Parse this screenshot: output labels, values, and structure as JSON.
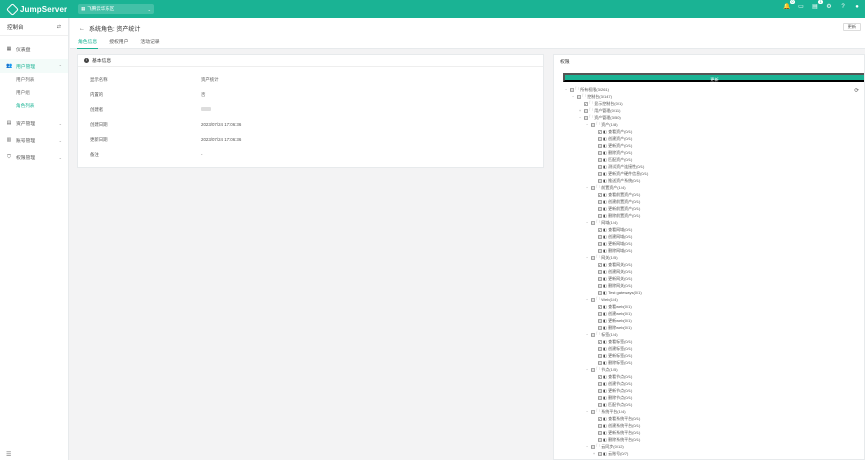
{
  "app": {
    "brand": "JumpServer",
    "org": "飞腾云华东区",
    "notif_count_1": "0",
    "notif_count_2": "1"
  },
  "colors": {
    "accent": "#1ab394"
  },
  "sidebar": {
    "title": "控制台",
    "items": [
      {
        "label": "仪表盘",
        "icon": "dashboard-icon"
      },
      {
        "label": "用户管理",
        "icon": "user-icon"
      },
      {
        "label": "资产管理",
        "icon": "asset-icon"
      },
      {
        "label": "账号管理",
        "icon": "account-icon"
      },
      {
        "label": "权限管理",
        "icon": "permission-icon"
      }
    ],
    "subitems": [
      {
        "label": "用户列表"
      },
      {
        "label": "用户组"
      },
      {
        "label": "角色列表"
      }
    ]
  },
  "header": {
    "title": "系统角色: 资产统计",
    "refresh_label": "更新",
    "tabs": [
      {
        "label": "角色信息"
      },
      {
        "label": "授权用户"
      },
      {
        "label": "活动记录"
      }
    ]
  },
  "info": {
    "title": "基本信息",
    "rows": [
      {
        "label": "显示名称",
        "value": "资产统计"
      },
      {
        "label": "内置的",
        "value": "否"
      },
      {
        "label": "创建者",
        "value": ""
      },
      {
        "label": "创建日期",
        "value": "2023/07/24 17:06:36"
      },
      {
        "label": "更新日期",
        "value": "2023/07/24 17:06:36"
      },
      {
        "label": "备注",
        "value": "-"
      }
    ]
  },
  "permissions": {
    "title": "权限",
    "update_label": "更新",
    "tree": [
      {
        "text": "所有权限(3/261)",
        "level": 0,
        "tog": "−",
        "cb": "□"
      },
      {
        "text": "控制台(3/147)",
        "level": 1,
        "tog": "−",
        "cb": "□"
      },
      {
        "text": "显示控制台(0/1)",
        "level": 2,
        "tog": "",
        "cb": "✓"
      },
      {
        "text": "用户管理(0/11)",
        "level": 2,
        "tog": "+",
        "cb": "□"
      },
      {
        "text": "资产管理(3/50)",
        "level": 2,
        "tog": "−",
        "cb": "□"
      },
      {
        "text": "资产(1/8)",
        "level": 3,
        "tog": "−",
        "cb": "□"
      },
      {
        "text": "查看资产(0/1)",
        "level": 4,
        "tog": "",
        "cb": "✓"
      },
      {
        "text": "创建资产(0/1)",
        "level": 4,
        "tog": "",
        "cb": "□"
      },
      {
        "text": "更新资产(0/1)",
        "level": 4,
        "tog": "",
        "cb": "□"
      },
      {
        "text": "删除资产(0/1)",
        "level": 4,
        "tog": "",
        "cb": "□"
      },
      {
        "text": "匹配资产(0/1)",
        "level": 4,
        "tog": "",
        "cb": "□"
      },
      {
        "text": "测试资产连接性(0/1)",
        "level": 4,
        "tog": "",
        "cb": "□"
      },
      {
        "text": "更新资产硬件信息(0/1)",
        "level": 4,
        "tog": "",
        "cb": "□"
      },
      {
        "text": "推送资产系统(0/1)",
        "level": 4,
        "tog": "",
        "cb": "□"
      },
      {
        "text": "前置资产(1/4)",
        "level": 3,
        "tog": "−",
        "cb": "□"
      },
      {
        "text": "查看前置资产(0/1)",
        "level": 4,
        "tog": "",
        "cb": "✓"
      },
      {
        "text": "创建前置资产(0/1)",
        "level": 4,
        "tog": "",
        "cb": "□"
      },
      {
        "text": "更新前置资产(0/1)",
        "level": 4,
        "tog": "",
        "cb": "□"
      },
      {
        "text": "删除前置资产(0/1)",
        "level": 4,
        "tog": "",
        "cb": "□"
      },
      {
        "text": "网域(1/4)",
        "level": 3,
        "tog": "−",
        "cb": "□"
      },
      {
        "text": "查看网域(0/1)",
        "level": 4,
        "tog": "",
        "cb": "✓"
      },
      {
        "text": "创建网域(0/1)",
        "level": 4,
        "tog": "",
        "cb": "□"
      },
      {
        "text": "更新网域(0/1)",
        "level": 4,
        "tog": "",
        "cb": "□"
      },
      {
        "text": "删除网域(0/1)",
        "level": 4,
        "tog": "",
        "cb": "□"
      },
      {
        "text": "网关(1/5)",
        "level": 3,
        "tog": "−",
        "cb": "□"
      },
      {
        "text": "查看网关(0/1)",
        "level": 4,
        "tog": "",
        "cb": "✓"
      },
      {
        "text": "创建网关(0/1)",
        "level": 4,
        "tog": "",
        "cb": "□"
      },
      {
        "text": "更新网关(0/1)",
        "level": 4,
        "tog": "",
        "cb": "□"
      },
      {
        "text": "删除网关(0/1)",
        "level": 4,
        "tog": "",
        "cb": "□"
      },
      {
        "text": "Test gateways(0/1)",
        "level": 4,
        "tog": "",
        "cb": "□"
      },
      {
        "text": "Web(1/4)",
        "level": 3,
        "tog": "−",
        "cb": "□"
      },
      {
        "text": "查看web(0/1)",
        "level": 4,
        "tog": "",
        "cb": "✓"
      },
      {
        "text": "创建web(0/1)",
        "level": 4,
        "tog": "",
        "cb": "□"
      },
      {
        "text": "更新web(0/1)",
        "level": 4,
        "tog": "",
        "cb": "□"
      },
      {
        "text": "删除web(0/1)",
        "level": 4,
        "tog": "",
        "cb": "□"
      },
      {
        "text": "标签(1/4)",
        "level": 3,
        "tog": "−",
        "cb": "□"
      },
      {
        "text": "查看标签(0/1)",
        "level": 4,
        "tog": "",
        "cb": "✓"
      },
      {
        "text": "创建标签(0/1)",
        "level": 4,
        "tog": "",
        "cb": "□"
      },
      {
        "text": "更新标签(0/1)",
        "level": 4,
        "tog": "",
        "cb": "□"
      },
      {
        "text": "删除标签(0/1)",
        "level": 4,
        "tog": "",
        "cb": "□"
      },
      {
        "text": "节点(1/5)",
        "level": 3,
        "tog": "−",
        "cb": "□"
      },
      {
        "text": "查看节点(0/1)",
        "level": 4,
        "tog": "",
        "cb": "✓"
      },
      {
        "text": "创建节点(0/1)",
        "level": 4,
        "tog": "",
        "cb": "□"
      },
      {
        "text": "更新节点(0/1)",
        "level": 4,
        "tog": "",
        "cb": "□"
      },
      {
        "text": "删除节点(0/1)",
        "level": 4,
        "tog": "",
        "cb": "□"
      },
      {
        "text": "匹配节点(0/1)",
        "level": 4,
        "tog": "",
        "cb": "□"
      },
      {
        "text": "系统平台(1/4)",
        "level": 3,
        "tog": "−",
        "cb": "□"
      },
      {
        "text": "查看系统平台(0/1)",
        "level": 4,
        "tog": "",
        "cb": "✓"
      },
      {
        "text": "创建系统平台(0/1)",
        "level": 4,
        "tog": "",
        "cb": "□"
      },
      {
        "text": "更新系统平台(0/1)",
        "level": 4,
        "tog": "",
        "cb": "□"
      },
      {
        "text": "删除系统平台(0/1)",
        "level": 4,
        "tog": "",
        "cb": "□"
      },
      {
        "text": "云同步(0/12)",
        "level": 3,
        "tog": "−",
        "cb": "□"
      },
      {
        "text": "云账号(0/7)",
        "level": 4,
        "tog": "+",
        "cb": "□"
      }
    ]
  }
}
